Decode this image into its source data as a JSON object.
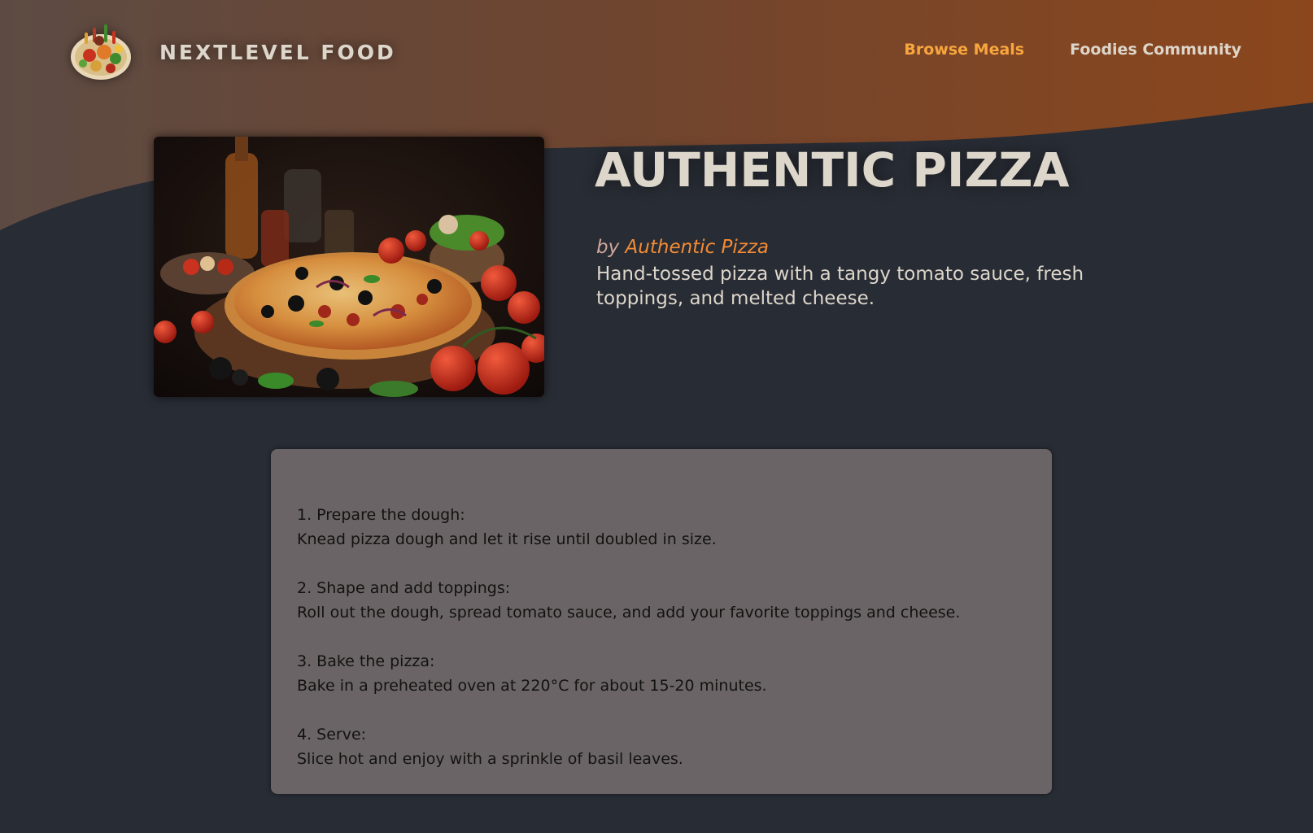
{
  "header": {
    "logo_text": "NEXTLEVEL FOOD",
    "nav": [
      {
        "label": "Browse Meals",
        "active": true
      },
      {
        "label": "Foodies Community",
        "active": false
      }
    ]
  },
  "meal": {
    "title": "AUTHENTIC PIZZA",
    "by_prefix": "by ",
    "creator": "Authentic Pizza",
    "summary": "Hand-tossed pizza with a tangy tomato sauce, fresh toppings, and melted cheese.",
    "image_icon": "pizza-photo"
  },
  "instructions": [
    {
      "title": "1. Prepare the dough:",
      "text": "Knead pizza dough and let it rise until doubled in size."
    },
    {
      "title": "2. Shape and add toppings:",
      "text": "Roll out the dough, spread tomato sauce, and add your favorite toppings and cheese."
    },
    {
      "title": "3. Bake the pizza:",
      "text": "Bake in a preheated oven at 220°C for about 15-20 minutes."
    },
    {
      "title": "4. Serve:",
      "text": "Slice hot and enjoy with a sprinkle of basil leaves."
    }
  ],
  "colors": {
    "background": "#282c34",
    "header_gradient_start": "#5a4a42",
    "header_gradient_end": "#8a4720",
    "accent": "#f9a63e",
    "creator_link": "#f38b34",
    "text_light": "#ddd6cb",
    "instructions_bg": "#6a6467"
  }
}
